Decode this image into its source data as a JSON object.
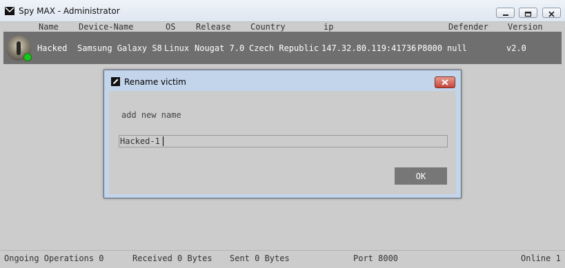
{
  "window": {
    "title": "Spy MAX - Administrator",
    "icon": "envelope-logo-icon"
  },
  "columns": [
    "Name",
    "Device-Name",
    "OS",
    "Release",
    "Country",
    "ip",
    "Defender",
    "Version"
  ],
  "victims": [
    {
      "name": "Hacked",
      "device": "Samsung Galaxy S8",
      "os": "Linux",
      "release": "Nougat 7.0",
      "country": "Czech Republic",
      "ip": "147.32.80.119:41736",
      "port": "P8000",
      "defender": "null",
      "version": "v2.0",
      "online": true,
      "status_color": "#1ec31e"
    }
  ],
  "dialog": {
    "title": "Rename victim",
    "label": "add new name",
    "input_value": "Hacked-1",
    "ok_label": "OK"
  },
  "status": {
    "operations": "Ongoing Operations 0",
    "received": "Received 0 Bytes",
    "sent": "Sent 0 Bytes",
    "port": "Port 8000",
    "online": "Online 1"
  },
  "colors": {
    "row_bg": "#6f6f6f",
    "dialog_frame": "#c3d5ea",
    "ok_button": "#777777",
    "close_button": "#c4463a"
  }
}
